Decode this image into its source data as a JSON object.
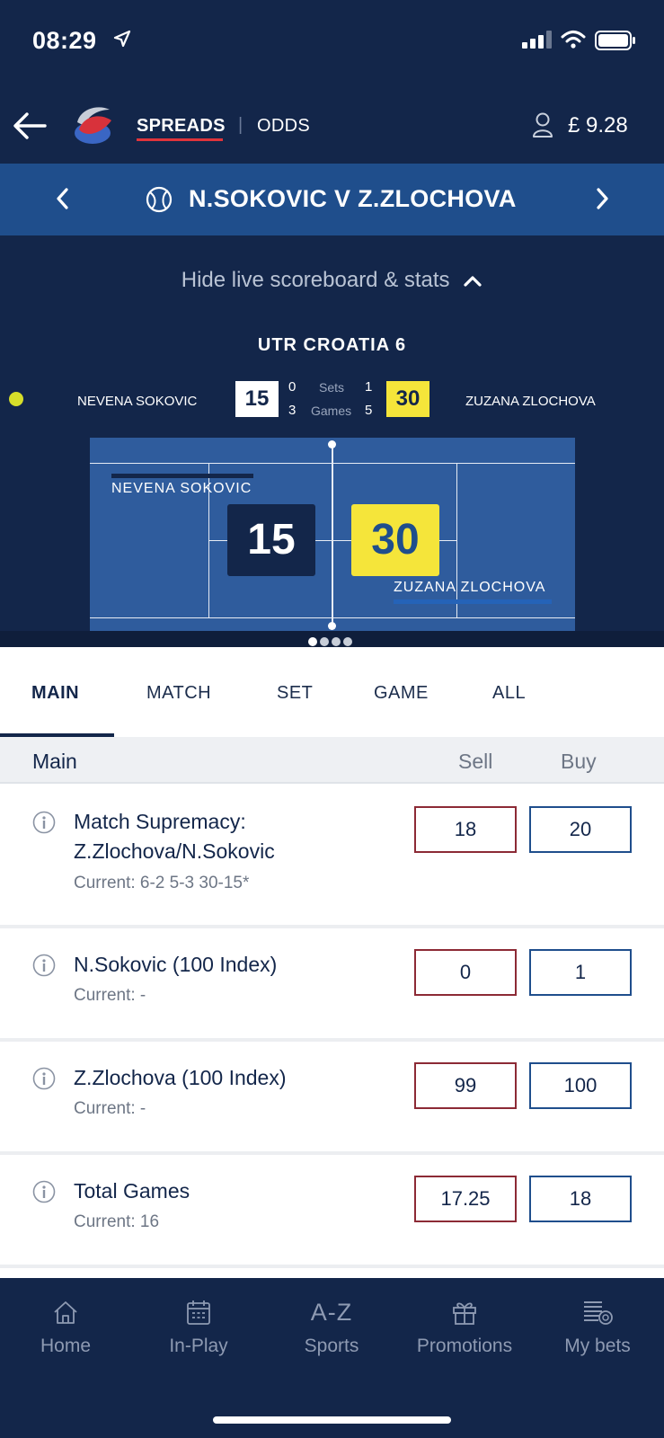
{
  "status_bar": {
    "time": "08:29"
  },
  "header": {
    "spreads_label": "SPREADS",
    "separator": "|",
    "odds_label": "ODDS",
    "balance": "£ 9.28"
  },
  "match_bar": {
    "title": "N.SOKOVIC V Z.ZLOCHOVA"
  },
  "scoreboard": {
    "toggle_label": "Hide live scoreboard & stats",
    "tournament": "UTR CROATIA 6",
    "player1": {
      "name": "NEVENA SOKOVIC",
      "points": "15",
      "sets": "0",
      "games": "3"
    },
    "player2": {
      "name": "ZUZANA ZLOCHOVA",
      "points": "30",
      "sets": "1",
      "games": "5"
    },
    "sets_label": "Sets",
    "games_label": "Games",
    "court": {
      "player1_name": "NEVENA SOKOVIC",
      "player2_name": "ZUZANA ZLOCHOVA",
      "player1_points": "15",
      "player2_points": "30"
    },
    "page_count": 4,
    "active_page": 1
  },
  "tabs": [
    {
      "label": "MAIN",
      "active": true
    },
    {
      "label": "MATCH"
    },
    {
      "label": "SET"
    },
    {
      "label": "GAME"
    },
    {
      "label": "ALL"
    }
  ],
  "section": {
    "title": "Main",
    "sell_label": "Sell",
    "buy_label": "Buy"
  },
  "markets": [
    {
      "name": "Match Supremacy: Z.Zlochova/N.Sokovic",
      "current": "Current: 6-2 5-3 30-15*",
      "sell": "18",
      "buy": "20"
    },
    {
      "name": "N.Sokovic (100 Index)",
      "current": "Current: -",
      "sell": "0",
      "buy": "1"
    },
    {
      "name": "Z.Zlochova (100 Index)",
      "current": "Current: -",
      "sell": "99",
      "buy": "100"
    },
    {
      "name": "Total Games",
      "current": "Current: 16",
      "sell": "17.25",
      "buy": "18"
    }
  ],
  "bottom_nav": {
    "home": "Home",
    "inplay": "In-Play",
    "sports_icon_text": "A-Z",
    "sports": "Sports",
    "promotions": "Promotions",
    "mybets": "My bets"
  },
  "colors": {
    "navy": "#13264a",
    "match_bar": "#1f4e8c",
    "court": "#2f5c9d",
    "highlight_yellow": "#f5e53a",
    "accent_red": "#e0343b",
    "sell_border": "#8c2a35",
    "buy_border": "#1f4e8c"
  }
}
